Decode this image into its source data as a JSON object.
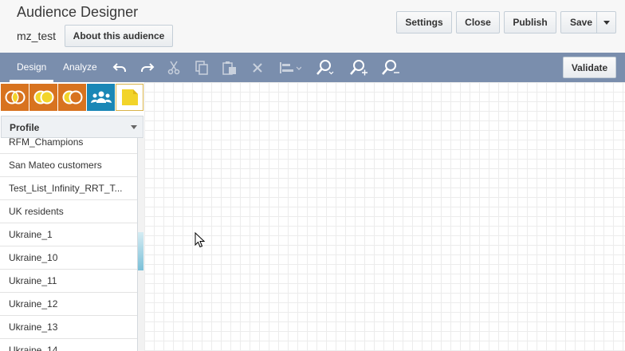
{
  "header": {
    "title": "Audience Designer",
    "audience_name": "mz_test",
    "about_button": "About this audience",
    "settings_button": "Settings",
    "close_button": "Close",
    "publish_button": "Publish",
    "save_button": "Save"
  },
  "toolbar": {
    "tabs": [
      {
        "label": "Design",
        "active": true
      },
      {
        "label": "Analyze",
        "active": false
      }
    ],
    "tools": [
      "undo-icon",
      "redo-icon",
      "cut-icon",
      "copy-icon",
      "paste-icon",
      "delete-icon",
      "align-icon",
      "zoom-fit-icon",
      "zoom-in-icon",
      "zoom-out-icon"
    ],
    "validate_button": "Validate"
  },
  "palette": {
    "items": [
      "intersect-icon",
      "union-icon",
      "exclude-icon",
      "segment-users-icon",
      "note-icon"
    ],
    "colors": {
      "orange": "#d8731f",
      "blue": "#1a87b6",
      "yellow": "#f2d42a"
    }
  },
  "profile": {
    "header": "Profile",
    "items": [
      "RFM_Champions",
      "San Mateo customers",
      "Test_List_Infinity_RRT_T...",
      "UK residents",
      "Ukraine_1",
      "Ukraine_10",
      "Ukraine_11",
      "Ukraine_12",
      "Ukraine_13",
      "Ukraine_14"
    ]
  },
  "theme": {
    "toolbar_bg": "#7a8ead",
    "header_bg": "#f7f7f7"
  }
}
